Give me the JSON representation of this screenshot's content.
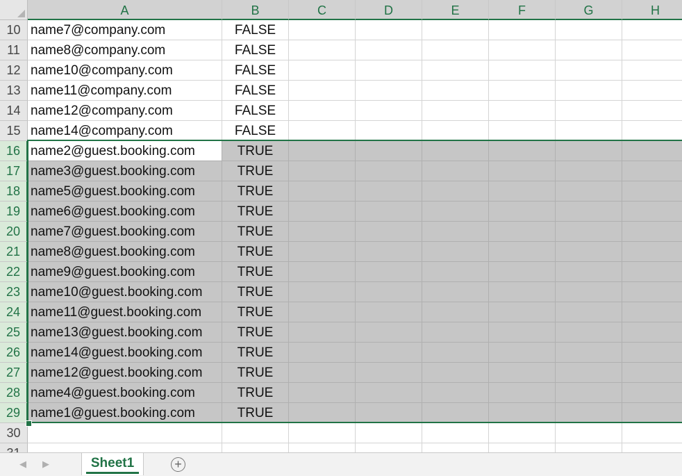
{
  "columns": [
    "A",
    "B",
    "C",
    "D",
    "E",
    "F",
    "G",
    "H"
  ],
  "rows": [
    {
      "num": "10",
      "a": "name7@company.com",
      "b": "FALSE"
    },
    {
      "num": "11",
      "a": "name8@company.com",
      "b": "FALSE"
    },
    {
      "num": "12",
      "a": "name10@company.com",
      "b": "FALSE"
    },
    {
      "num": "13",
      "a": "name11@company.com",
      "b": "FALSE"
    },
    {
      "num": "14",
      "a": "name12@company.com",
      "b": "FALSE"
    },
    {
      "num": "15",
      "a": "name14@company.com",
      "b": "FALSE"
    },
    {
      "num": "16",
      "a": "name2@guest.booking.com",
      "b": "TRUE"
    },
    {
      "num": "17",
      "a": "name3@guest.booking.com",
      "b": "TRUE"
    },
    {
      "num": "18",
      "a": "name5@guest.booking.com",
      "b": "TRUE"
    },
    {
      "num": "19",
      "a": "name6@guest.booking.com",
      "b": "TRUE"
    },
    {
      "num": "20",
      "a": "name7@guest.booking.com",
      "b": "TRUE"
    },
    {
      "num": "21",
      "a": "name8@guest.booking.com",
      "b": "TRUE"
    },
    {
      "num": "22",
      "a": "name9@guest.booking.com",
      "b": "TRUE"
    },
    {
      "num": "23",
      "a": "name10@guest.booking.com",
      "b": "TRUE"
    },
    {
      "num": "24",
      "a": "name11@guest.booking.com",
      "b": "TRUE"
    },
    {
      "num": "25",
      "a": "name13@guest.booking.com",
      "b": "TRUE"
    },
    {
      "num": "26",
      "a": "name14@guest.booking.com",
      "b": "TRUE"
    },
    {
      "num": "27",
      "a": "name12@guest.booking.com",
      "b": "TRUE"
    },
    {
      "num": "28",
      "a": "name4@guest.booking.com",
      "b": "TRUE"
    },
    {
      "num": "29",
      "a": "name1@guest.booking.com",
      "b": "TRUE"
    },
    {
      "num": "30",
      "a": "",
      "b": ""
    },
    {
      "num": "31",
      "a": "",
      "b": ""
    }
  ],
  "selection": {
    "first_row": "16",
    "last_row": "29",
    "active_cell": "A16"
  },
  "tabs": {
    "sheet_name": "Sheet1",
    "prev_icon": "◀",
    "next_icon": "▶",
    "add_icon": "+"
  },
  "colors": {
    "accent": "#217346",
    "selected_fill": "#c6c6c6"
  }
}
